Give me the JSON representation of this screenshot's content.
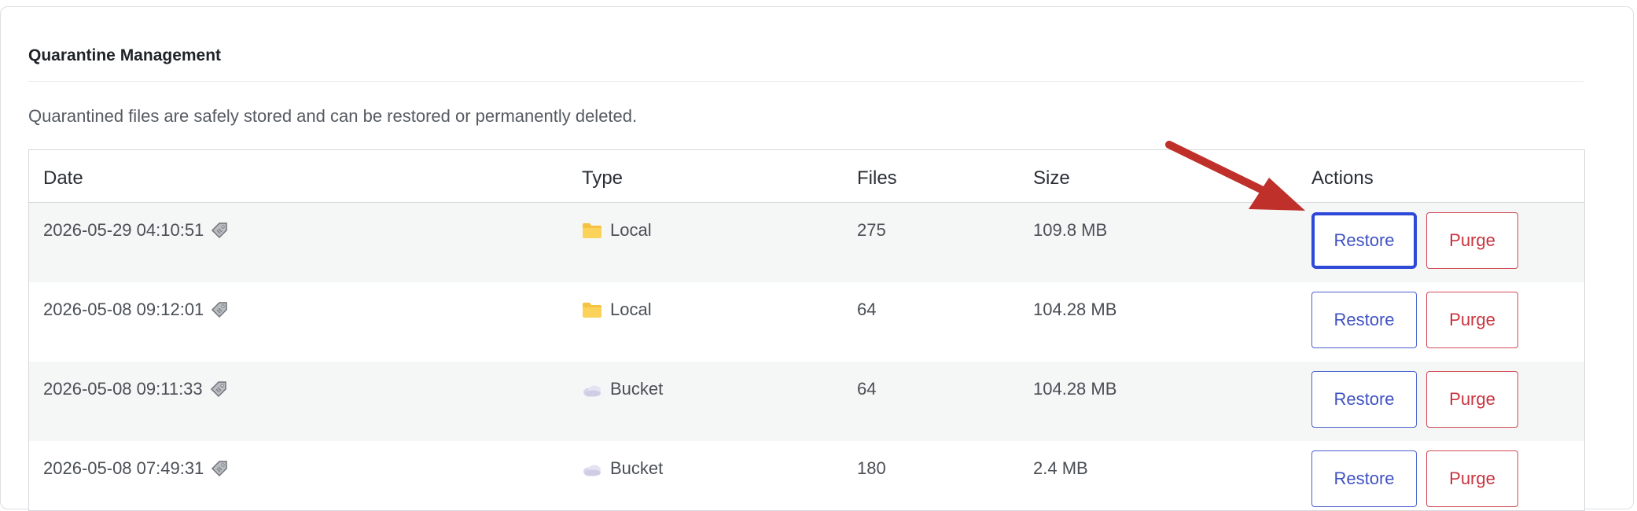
{
  "panel": {
    "title": "Quarantine Management",
    "description": "Quarantined files are safely stored and can be restored or permanently deleted."
  },
  "table": {
    "columns": [
      "Date",
      "Type",
      "Files",
      "Size",
      "Actions"
    ],
    "rows": [
      {
        "date": "2026-05-29 04:10:51",
        "type": "Local",
        "type_icon": "folder-icon",
        "files": "275",
        "size": "109.8 MB",
        "restore": "Restore",
        "purge": "Purge"
      },
      {
        "date": "2026-05-08 09:12:01",
        "type": "Local",
        "type_icon": "folder-icon",
        "files": "64",
        "size": "104.28 MB",
        "restore": "Restore",
        "purge": "Purge"
      },
      {
        "date": "2026-05-08 09:11:33",
        "type": "Bucket",
        "type_icon": "cloud-icon",
        "files": "64",
        "size": "104.28 MB",
        "restore": "Restore",
        "purge": "Purge"
      },
      {
        "date": "2026-05-08 07:49:31",
        "type": "Bucket",
        "type_icon": "cloud-icon",
        "files": "180",
        "size": "2.4 MB",
        "restore": "Restore",
        "purge": "Purge"
      }
    ]
  },
  "colors": {
    "restore": "#3f51c2",
    "purge": "#c9323d",
    "arrow": "#c0302b",
    "folder": "#f5c242"
  }
}
